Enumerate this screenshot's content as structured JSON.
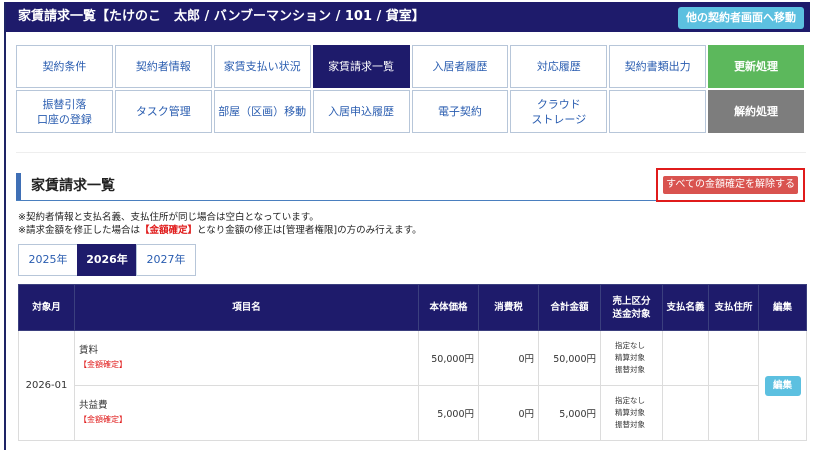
{
  "header": {
    "title": "家賃請求一覧【たけのこ　太郎 / バンブーマンション / 101 / 貸室】",
    "other_contractor_button": "他の契約者画面へ移動"
  },
  "nav": {
    "row1": [
      "契約条件",
      "契約者情報",
      "家賃支払い状況",
      "家賃請求一覧",
      "入居者履歴",
      "対応履歴",
      "契約書類出力",
      "更新処理"
    ],
    "row2": [
      "振替引落\n口座の登録",
      "タスク管理",
      "部屋（区画）移動",
      "入居申込履歴",
      "電子契約",
      "クラウド\nストレージ",
      "",
      "解約処理"
    ],
    "active": "家賃請求一覧"
  },
  "section": {
    "title": "家賃請求一覧",
    "unlock_all_button": "すべての金額確定を解除する"
  },
  "notes": {
    "line1": "※契約者情報と支払名義、支払住所が同じ場合は空白となっています。",
    "line2_pre": "※請求金額を修正した場合は",
    "line2_tag": "【金額確定】",
    "line2_post": "となり金額の修正は[管理者権限]の方のみ行えます。"
  },
  "year_tabs": [
    "2025年",
    "2026年",
    "2027年"
  ],
  "year_active": "2026年",
  "table": {
    "headers": {
      "month": "対象月",
      "item": "項目名",
      "base": "本体価格",
      "tax": "消費税",
      "total": "合計金額",
      "sales": "売上区分\n送金対象",
      "payer_name": "支払名義",
      "payer_address": "支払住所",
      "edit": "編集"
    },
    "month": "2026-01",
    "edit_label": "編集",
    "rows": [
      {
        "item": "賃料",
        "tag": "【金額確定】",
        "base": "50,000円",
        "tax": "0円",
        "total": "50,000円",
        "sales": [
          "指定なし",
          "精算対象",
          "振替対象"
        ]
      },
      {
        "item": "共益費",
        "tag": "【金額確定】",
        "base": "5,000円",
        "tax": "0円",
        "total": "5,000円",
        "sales": [
          "指定なし",
          "精算対象",
          "振替対象"
        ]
      }
    ]
  }
}
